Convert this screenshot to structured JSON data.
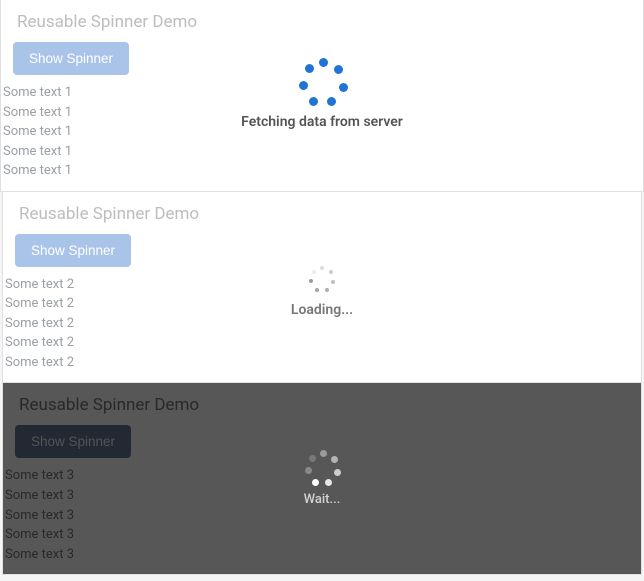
{
  "panels": [
    {
      "title": "Reusable Spinner Demo",
      "button_label": "Show Spinner",
      "lines": [
        "Some text 1",
        "Some text 1",
        "Some text 1",
        "Some text 1",
        "Some text 1"
      ],
      "overlay": {
        "style": "light",
        "spinner_color": "#1f74d6",
        "spinner_size": "large",
        "message": "Fetching data from server"
      }
    },
    {
      "title": "Reusable Spinner Demo",
      "button_label": "Show Spinner",
      "lines": [
        "Some text 2",
        "Some text 2",
        "Some text 2",
        "Some text 2",
        "Some text 2"
      ],
      "overlay": {
        "style": "light",
        "spinner_color": "#9b9b9b",
        "spinner_size": "small",
        "message": "Loading..."
      }
    },
    {
      "title": "Reusable Spinner Demo",
      "button_label": "Show Spinner",
      "lines": [
        "Some text 3",
        "Some text 3",
        "Some text 3",
        "Some text 3",
        "Some text 3"
      ],
      "overlay": {
        "style": "dark",
        "spinner_color": "#ffffff",
        "spinner_size": "medium",
        "message": "Wait..."
      }
    }
  ],
  "colors": {
    "button_light": "#a9c4e8",
    "button_dark": "#0f2e57",
    "overlay_dark": "rgba(40,40,40,0.78)"
  }
}
